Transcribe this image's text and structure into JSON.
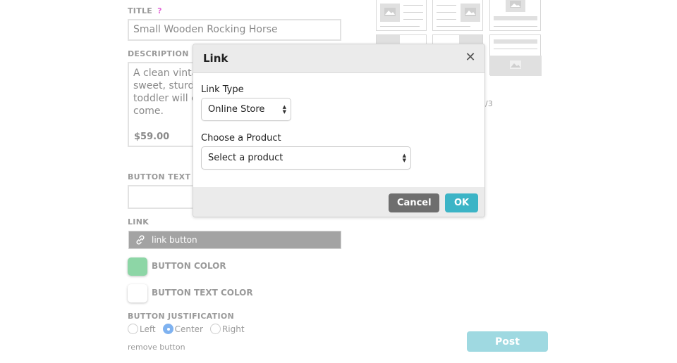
{
  "form": {
    "title_label": "TITLE",
    "help_glyph": "?",
    "title_value": "Small Wooden Rocking Horse",
    "description_label": "DESCRIPTION",
    "description_lines": [
      "A clean vinta",
      "sweet, sturdy",
      "toddler will e",
      "come."
    ],
    "description_price": "$59.00",
    "button_text_label": "BUTTON TEXT",
    "button_text_value": "",
    "link_label": "LINK",
    "link_value": "link button",
    "button_color_label": "BUTTON COLOR",
    "button_color": "#8dd6a6",
    "button_text_color_label": "BUTTON TEXT COLOR",
    "button_text_color": "#ffffff",
    "justification_label": "BUTTON JUSTIFICATION",
    "justification_options": [
      "Left",
      "Center",
      "Right"
    ],
    "justification_selected": "Center",
    "remove_label": "remove button"
  },
  "layouts": {
    "pager_text": "/3"
  },
  "post_label": "Post",
  "modal": {
    "title": "Link",
    "close_glyph": "✕",
    "link_type_label": "Link Type",
    "link_type_value": "Online Store",
    "product_label": "Choose a Product",
    "product_value": "Select a product",
    "cancel_label": "Cancel",
    "ok_label": "OK"
  },
  "colors": {
    "accent": "#3cb4c6",
    "help": "#e36ad8",
    "cancel": "#6e6e6e"
  }
}
